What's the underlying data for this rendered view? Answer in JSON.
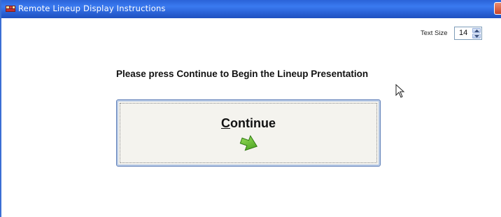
{
  "window": {
    "title": "Remote Lineup Display Instructions",
    "icon": "app-icon",
    "titlebar_color": "#2a63d8"
  },
  "text_size": {
    "label": "Text Size",
    "value": "14"
  },
  "main": {
    "instruction": "Please press Continue to Begin the Lineup Presentation",
    "continue_button": {
      "label_mnemonic": "C",
      "label_rest": "ontinue",
      "icon": "green-arrow-icon",
      "icon_color": "#5fbf2a"
    }
  }
}
